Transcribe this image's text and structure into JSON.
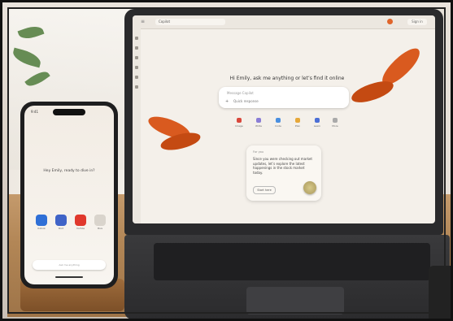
{
  "laptop": {
    "tab_title": "Copilot",
    "signin_label": "Sign in",
    "greeting": "Hi Emily, ask me anything or let’s find it online",
    "search_placeholder": "Message Copilot",
    "search_chip": "Quick response",
    "shortcuts": [
      {
        "label": "Image",
        "color": "#d9473b"
      },
      {
        "label": "Write",
        "color": "#8a7dd6"
      },
      {
        "label": "Code",
        "color": "#4a8fe0"
      },
      {
        "label": "Plan",
        "color": "#e6a83a"
      },
      {
        "label": "Learn",
        "color": "#4c6fd6"
      },
      {
        "label": "More",
        "color": "#aaaaaa"
      }
    ],
    "card": {
      "title": "For you",
      "text": "Since you were checking out market updates, let’s explore the latest happenings in the stock market today.",
      "button": "Start here"
    }
  },
  "phone": {
    "time": "9:41",
    "greeting": "Hey Emily, ready to dive in?",
    "apps": [
      {
        "label": "Outlook",
        "color": "#2f6fd6"
      },
      {
        "label": "Word",
        "color": "#3f63c7"
      },
      {
        "label": "YouTube",
        "color": "#e0382c"
      },
      {
        "label": "More",
        "color": "#d9d4cc"
      }
    ],
    "input_placeholder": "Ask me anything"
  },
  "colors": {
    "flower": "#d95a1f",
    "screen_bg": "#f4f0ea",
    "desk": "#b28656"
  }
}
